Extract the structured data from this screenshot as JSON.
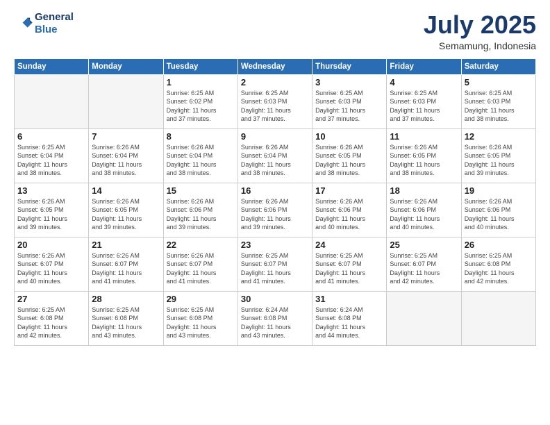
{
  "logo": {
    "line1": "General",
    "line2": "Blue"
  },
  "title": "July 2025",
  "subtitle": "Semamung, Indonesia",
  "header_days": [
    "Sunday",
    "Monday",
    "Tuesday",
    "Wednesday",
    "Thursday",
    "Friday",
    "Saturday"
  ],
  "weeks": [
    [
      {
        "day": "",
        "info": ""
      },
      {
        "day": "",
        "info": ""
      },
      {
        "day": "1",
        "info": "Sunrise: 6:25 AM\nSunset: 6:02 PM\nDaylight: 11 hours\nand 37 minutes."
      },
      {
        "day": "2",
        "info": "Sunrise: 6:25 AM\nSunset: 6:03 PM\nDaylight: 11 hours\nand 37 minutes."
      },
      {
        "day": "3",
        "info": "Sunrise: 6:25 AM\nSunset: 6:03 PM\nDaylight: 11 hours\nand 37 minutes."
      },
      {
        "day": "4",
        "info": "Sunrise: 6:25 AM\nSunset: 6:03 PM\nDaylight: 11 hours\nand 37 minutes."
      },
      {
        "day": "5",
        "info": "Sunrise: 6:25 AM\nSunset: 6:03 PM\nDaylight: 11 hours\nand 38 minutes."
      }
    ],
    [
      {
        "day": "6",
        "info": "Sunrise: 6:25 AM\nSunset: 6:04 PM\nDaylight: 11 hours\nand 38 minutes."
      },
      {
        "day": "7",
        "info": "Sunrise: 6:26 AM\nSunset: 6:04 PM\nDaylight: 11 hours\nand 38 minutes."
      },
      {
        "day": "8",
        "info": "Sunrise: 6:26 AM\nSunset: 6:04 PM\nDaylight: 11 hours\nand 38 minutes."
      },
      {
        "day": "9",
        "info": "Sunrise: 6:26 AM\nSunset: 6:04 PM\nDaylight: 11 hours\nand 38 minutes."
      },
      {
        "day": "10",
        "info": "Sunrise: 6:26 AM\nSunset: 6:05 PM\nDaylight: 11 hours\nand 38 minutes."
      },
      {
        "day": "11",
        "info": "Sunrise: 6:26 AM\nSunset: 6:05 PM\nDaylight: 11 hours\nand 38 minutes."
      },
      {
        "day": "12",
        "info": "Sunrise: 6:26 AM\nSunset: 6:05 PM\nDaylight: 11 hours\nand 39 minutes."
      }
    ],
    [
      {
        "day": "13",
        "info": "Sunrise: 6:26 AM\nSunset: 6:05 PM\nDaylight: 11 hours\nand 39 minutes."
      },
      {
        "day": "14",
        "info": "Sunrise: 6:26 AM\nSunset: 6:05 PM\nDaylight: 11 hours\nand 39 minutes."
      },
      {
        "day": "15",
        "info": "Sunrise: 6:26 AM\nSunset: 6:06 PM\nDaylight: 11 hours\nand 39 minutes."
      },
      {
        "day": "16",
        "info": "Sunrise: 6:26 AM\nSunset: 6:06 PM\nDaylight: 11 hours\nand 39 minutes."
      },
      {
        "day": "17",
        "info": "Sunrise: 6:26 AM\nSunset: 6:06 PM\nDaylight: 11 hours\nand 40 minutes."
      },
      {
        "day": "18",
        "info": "Sunrise: 6:26 AM\nSunset: 6:06 PM\nDaylight: 11 hours\nand 40 minutes."
      },
      {
        "day": "19",
        "info": "Sunrise: 6:26 AM\nSunset: 6:06 PM\nDaylight: 11 hours\nand 40 minutes."
      }
    ],
    [
      {
        "day": "20",
        "info": "Sunrise: 6:26 AM\nSunset: 6:07 PM\nDaylight: 11 hours\nand 40 minutes."
      },
      {
        "day": "21",
        "info": "Sunrise: 6:26 AM\nSunset: 6:07 PM\nDaylight: 11 hours\nand 41 minutes."
      },
      {
        "day": "22",
        "info": "Sunrise: 6:26 AM\nSunset: 6:07 PM\nDaylight: 11 hours\nand 41 minutes."
      },
      {
        "day": "23",
        "info": "Sunrise: 6:25 AM\nSunset: 6:07 PM\nDaylight: 11 hours\nand 41 minutes."
      },
      {
        "day": "24",
        "info": "Sunrise: 6:25 AM\nSunset: 6:07 PM\nDaylight: 11 hours\nand 41 minutes."
      },
      {
        "day": "25",
        "info": "Sunrise: 6:25 AM\nSunset: 6:07 PM\nDaylight: 11 hours\nand 42 minutes."
      },
      {
        "day": "26",
        "info": "Sunrise: 6:25 AM\nSunset: 6:08 PM\nDaylight: 11 hours\nand 42 minutes."
      }
    ],
    [
      {
        "day": "27",
        "info": "Sunrise: 6:25 AM\nSunset: 6:08 PM\nDaylight: 11 hours\nand 42 minutes."
      },
      {
        "day": "28",
        "info": "Sunrise: 6:25 AM\nSunset: 6:08 PM\nDaylight: 11 hours\nand 43 minutes."
      },
      {
        "day": "29",
        "info": "Sunrise: 6:25 AM\nSunset: 6:08 PM\nDaylight: 11 hours\nand 43 minutes."
      },
      {
        "day": "30",
        "info": "Sunrise: 6:24 AM\nSunset: 6:08 PM\nDaylight: 11 hours\nand 43 minutes."
      },
      {
        "day": "31",
        "info": "Sunrise: 6:24 AM\nSunset: 6:08 PM\nDaylight: 11 hours\nand 44 minutes."
      },
      {
        "day": "",
        "info": ""
      },
      {
        "day": "",
        "info": ""
      }
    ]
  ]
}
